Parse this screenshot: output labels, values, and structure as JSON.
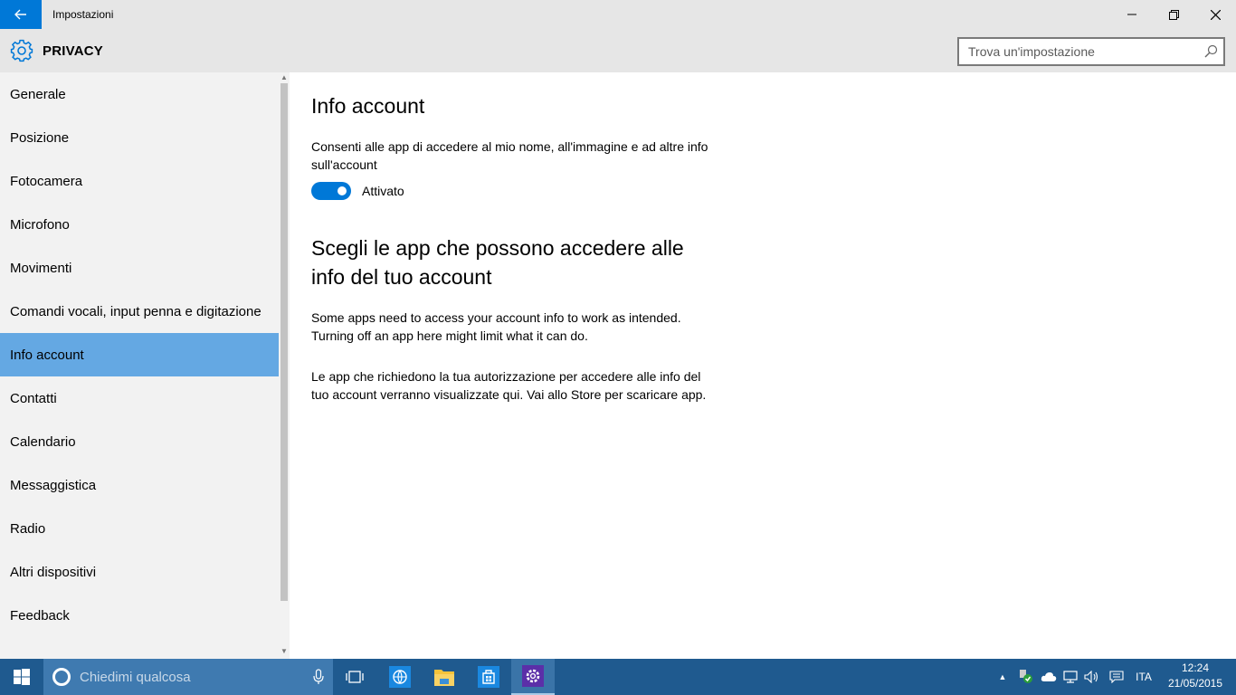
{
  "window": {
    "title": "Impostazioni"
  },
  "header": {
    "section_title": "PRIVACY",
    "search_placeholder": "Trova un'impostazione"
  },
  "sidebar": {
    "items": [
      {
        "label": "Generale",
        "active": false
      },
      {
        "label": "Posizione",
        "active": false
      },
      {
        "label": "Fotocamera",
        "active": false
      },
      {
        "label": "Microfono",
        "active": false
      },
      {
        "label": "Movimenti",
        "active": false
      },
      {
        "label": "Comandi vocali, input penna e digitazione",
        "active": false
      },
      {
        "label": "Info account",
        "active": true
      },
      {
        "label": "Contatti",
        "active": false
      },
      {
        "label": "Calendario",
        "active": false
      },
      {
        "label": "Messaggistica",
        "active": false
      },
      {
        "label": "Radio",
        "active": false
      },
      {
        "label": "Altri dispositivi",
        "active": false
      },
      {
        "label": "Feedback",
        "active": false
      }
    ]
  },
  "main": {
    "title": "Info account",
    "toggle_description": "Consenti alle app di accedere al mio nome, all'immagine e ad altre info sull'account",
    "toggle_state_label": "Attivato",
    "toggle_on": true,
    "section_title": "Scegli le app che possono accedere alle info del tuo account",
    "info_text": "Some apps need to access your account info to work as intended. Turning off an app here might limit what it can do.",
    "store_text": "Le app che richiedono la tua autorizzazione per accedere alle info del tuo account verranno visualizzate qui. Vai allo Store per scaricare app."
  },
  "taskbar": {
    "search_placeholder": "Chiedimi qualcosa",
    "language": "ITA",
    "time": "12:24",
    "date": "21/05/2015"
  },
  "colors": {
    "accent": "#0078d7",
    "selected_nav": "#64a8e3",
    "taskbar": "#1f5a8f"
  }
}
